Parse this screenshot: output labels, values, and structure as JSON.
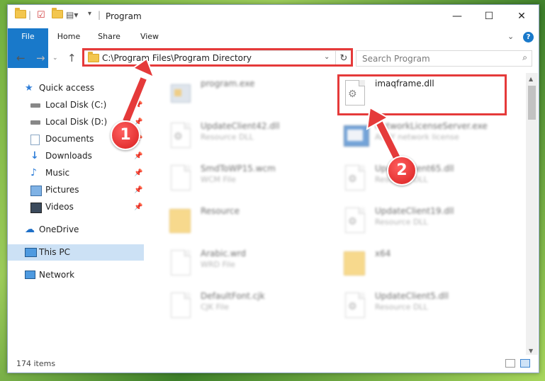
{
  "window": {
    "title": "Program",
    "buttons": {
      "minimize": "—",
      "maximize": "☐",
      "close": "✕"
    }
  },
  "ribbon": {
    "tabs": [
      "File",
      "Home",
      "Share",
      "View"
    ],
    "help": "?"
  },
  "navigation": {
    "address": "C:\\Program Files\\Program Directory",
    "search_placeholder": "Search Program"
  },
  "sidebar": {
    "items": [
      {
        "label": "Quick access",
        "icon": "star-icon",
        "pinned": false
      },
      {
        "label": "Local Disk (C:)",
        "icon": "drive-icon",
        "pinned": true
      },
      {
        "label": "Local Disk (D:)",
        "icon": "drive-icon",
        "pinned": true
      },
      {
        "label": "Documents",
        "icon": "documents-icon",
        "pinned": true
      },
      {
        "label": "Downloads",
        "icon": "download-icon",
        "pinned": true
      },
      {
        "label": "Music",
        "icon": "music-icon",
        "pinned": true
      },
      {
        "label": "Pictures",
        "icon": "pictures-icon",
        "pinned": true
      },
      {
        "label": "Videos",
        "icon": "videos-icon",
        "pinned": true
      },
      {
        "label": "OneDrive",
        "icon": "cloud-icon",
        "pinned": false
      },
      {
        "label": "This PC",
        "icon": "computer-icon",
        "pinned": false,
        "selected": true
      },
      {
        "label": "Network",
        "icon": "network-icon",
        "pinned": false
      }
    ]
  },
  "files": [
    {
      "name": "program.exe",
      "type": "",
      "icon": "exe-icon"
    },
    {
      "name": "imaqframe.dll",
      "type": "",
      "icon": "dll-gear-icon",
      "highlighted": true
    },
    {
      "name": "UpdateClient42.dll",
      "type": "Resource DLL",
      "icon": "dll-gear-icon"
    },
    {
      "name": "NetworkLicenseServer.exe",
      "type": "ABBY network license",
      "icon": "app-icon"
    },
    {
      "name": "SmdToWP15.wcm",
      "type": "WCM File",
      "icon": "document-icon"
    },
    {
      "name": "UpdateClient65.dll",
      "type": "Resource DLL",
      "icon": "dll-gear-icon"
    },
    {
      "name": "Resource",
      "type": "",
      "icon": "folder-icon"
    },
    {
      "name": "UpdateClient19.dll",
      "type": "Resource DLL",
      "icon": "dll-gear-icon"
    },
    {
      "name": "Arabic.wrd",
      "type": "WRD File",
      "icon": "document-icon"
    },
    {
      "name": "x64",
      "type": "",
      "icon": "folder-icon"
    },
    {
      "name": "DefaultFont.cjk",
      "type": "CJK File",
      "icon": "document-icon"
    },
    {
      "name": "UpdateClient5.dll",
      "type": "Resource DLL",
      "icon": "dll-gear-icon"
    }
  ],
  "status": {
    "item_count": "174 items"
  },
  "annotations": {
    "marker1": "1",
    "marker2": "2",
    "color": "#e53a3a"
  }
}
